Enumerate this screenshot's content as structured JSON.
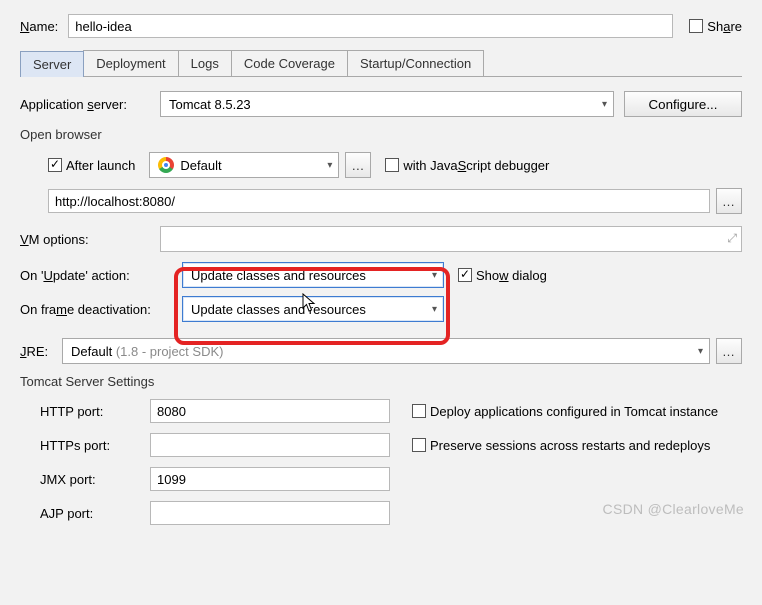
{
  "name": {
    "label": "Name:",
    "value": "hello-idea"
  },
  "share": {
    "label": "Share",
    "checked": false
  },
  "tabs": [
    "Server",
    "Deployment",
    "Logs",
    "Code Coverage",
    "Startup/Connection"
  ],
  "app_server": {
    "label": "Application server:",
    "value": "Tomcat 8.5.23",
    "configure": "Configure..."
  },
  "open_browser": {
    "title": "Open browser",
    "after_launch": {
      "label": "After launch",
      "checked": true
    },
    "browser": "Default",
    "js_debugger": {
      "label": "with JavaScript debugger",
      "checked": false
    },
    "url": "http://localhost:8080/"
  },
  "vm": {
    "label": "VM options:"
  },
  "update_action": {
    "label": "On 'Update' action:",
    "value": "Update classes and resources"
  },
  "show_dialog": {
    "label": "Show dialog",
    "checked": true
  },
  "frame_deact": {
    "label": "On frame deactivation:",
    "value": "Update classes and resources"
  },
  "jre": {
    "label": "JRE:",
    "value": "Default",
    "hint": " (1.8 - project SDK)"
  },
  "tomcat": {
    "title": "Tomcat Server Settings",
    "http": {
      "label": "HTTP port:",
      "value": "8080"
    },
    "https": {
      "label": "HTTPs port:",
      "value": ""
    },
    "jmx": {
      "label": "JMX port:",
      "value": "1099"
    },
    "ajp": {
      "label": "AJP port:",
      "value": ""
    },
    "deploy": {
      "label": "Deploy applications configured in Tomcat instance",
      "checked": false
    },
    "preserve": {
      "label": "Preserve sessions across restarts and redeploys",
      "checked": false
    }
  },
  "watermark": "CSDN @ClearloveMe"
}
